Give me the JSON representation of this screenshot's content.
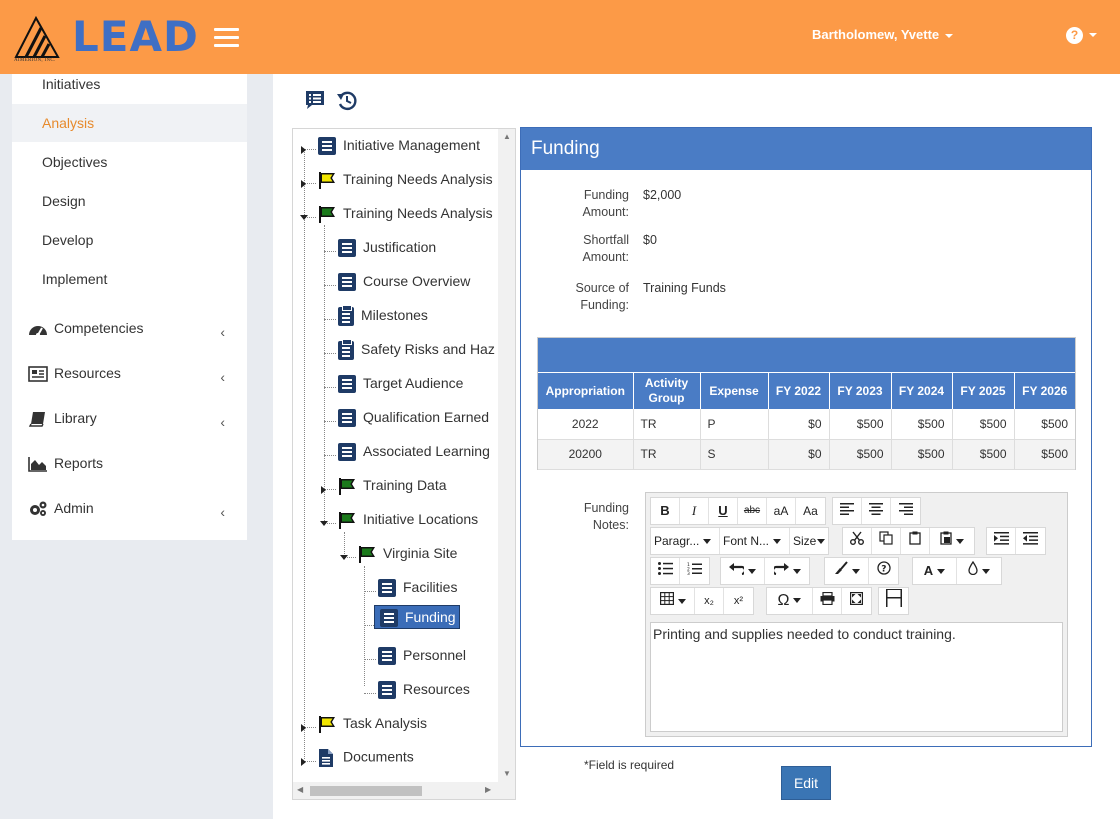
{
  "header": {
    "logo_text": "LEAD",
    "logo_sub": "AIMERION, INC.",
    "user_name": "Bartholomew, Yvette",
    "help_glyph": "?"
  },
  "colors": {
    "header_bg": "#fc9a47",
    "accent_blue": "#4a7cc5",
    "active_text": "#e78a2c",
    "flag_green": "#1b7a1b",
    "flag_yellow": "#f2e600",
    "tree_doc": "#1f3b66"
  },
  "sidebar": {
    "sub_items": [
      {
        "label": "Initiatives"
      },
      {
        "label": "Analysis"
      },
      {
        "label": "Objectives"
      },
      {
        "label": "Design"
      },
      {
        "label": "Develop"
      },
      {
        "label": "Implement"
      }
    ],
    "main_items": [
      {
        "label": "Competencies",
        "icon": "dashboard-icon",
        "expandable": true
      },
      {
        "label": "Resources",
        "icon": "newspaper-icon",
        "expandable": true
      },
      {
        "label": "Library",
        "icon": "book-icon",
        "expandable": true
      },
      {
        "label": "Reports",
        "icon": "area-chart-icon",
        "expandable": false
      },
      {
        "label": "Admin",
        "icon": "cogs-icon",
        "expandable": true
      }
    ],
    "chevron": "‹"
  },
  "toolbar_icons": [
    "comments-list-icon",
    "history-icon"
  ],
  "tree": {
    "nodes": [
      {
        "label": "Initiative Management",
        "icon": "document-icon"
      },
      {
        "label": "Training Needs Analysis",
        "icon": "yellow-flag-icon"
      },
      {
        "label": "Training Needs Analysis",
        "icon": "green-flag-icon"
      },
      {
        "label": "Justification",
        "icon": "document-icon"
      },
      {
        "label": "Course Overview",
        "icon": "document-icon"
      },
      {
        "label": "Milestones",
        "icon": "clipboard-icon"
      },
      {
        "label": "Safety Risks and Haz",
        "icon": "clipboard-icon"
      },
      {
        "label": "Target Audience",
        "icon": "document-icon"
      },
      {
        "label": "Qualification Earned",
        "icon": "document-icon"
      },
      {
        "label": "Associated Learning",
        "icon": "document-icon"
      },
      {
        "label": "Training Data",
        "icon": "green-flag-icon"
      },
      {
        "label": "Initiative Locations",
        "icon": "green-flag-icon"
      },
      {
        "label": "Virginia Site",
        "icon": "green-flag-icon"
      },
      {
        "label": "Facilities",
        "icon": "document-icon"
      },
      {
        "label": "Funding",
        "icon": "document-icon",
        "selected": true
      },
      {
        "label": "Personnel",
        "icon": "document-icon"
      },
      {
        "label": "Resources",
        "icon": "document-icon"
      },
      {
        "label": "Task Analysis",
        "icon": "yellow-flag-icon"
      },
      {
        "label": "Documents",
        "icon": "folded-document-icon"
      }
    ]
  },
  "funding": {
    "title": "Funding",
    "fields": [
      {
        "label_1": "Funding",
        "label_2": "Amount:",
        "value": "$2,000"
      },
      {
        "label_1": "Shortfall",
        "label_2": "Amount:",
        "value": "$0"
      },
      {
        "label_1": "Source of",
        "label_2": "Funding:",
        "value": "Training Funds"
      }
    ],
    "table": {
      "columns": [
        "Appropriation",
        "Activity Group",
        "Expense",
        "FY 2022",
        "FY 2023",
        "FY 2024",
        "FY 2025",
        "FY 2026"
      ],
      "rows": [
        [
          "2022",
          "TR",
          "P",
          "$0",
          "$500",
          "$500",
          "$500",
          "$500"
        ],
        [
          "20200",
          "TR",
          "S",
          "$0",
          "$500",
          "$500",
          "$500",
          "$500"
        ]
      ]
    },
    "notes_label_1": "Funding",
    "notes_label_2": "Notes:",
    "editor": {
      "paragraph_dd": "Paragr...",
      "font_dd": "Font N...",
      "size_dd": "Size",
      "bold": "B",
      "italic": "I",
      "underline": "U",
      "strike": "abc",
      "upper": "aA",
      "capital": "Aa",
      "font_color": "A",
      "omega": "Ω",
      "sub": "x₂",
      "sup": "x²",
      "content": "Printing and supplies needed to conduct training."
    },
    "required_note": "*Field is required",
    "edit_label": "Edit"
  }
}
